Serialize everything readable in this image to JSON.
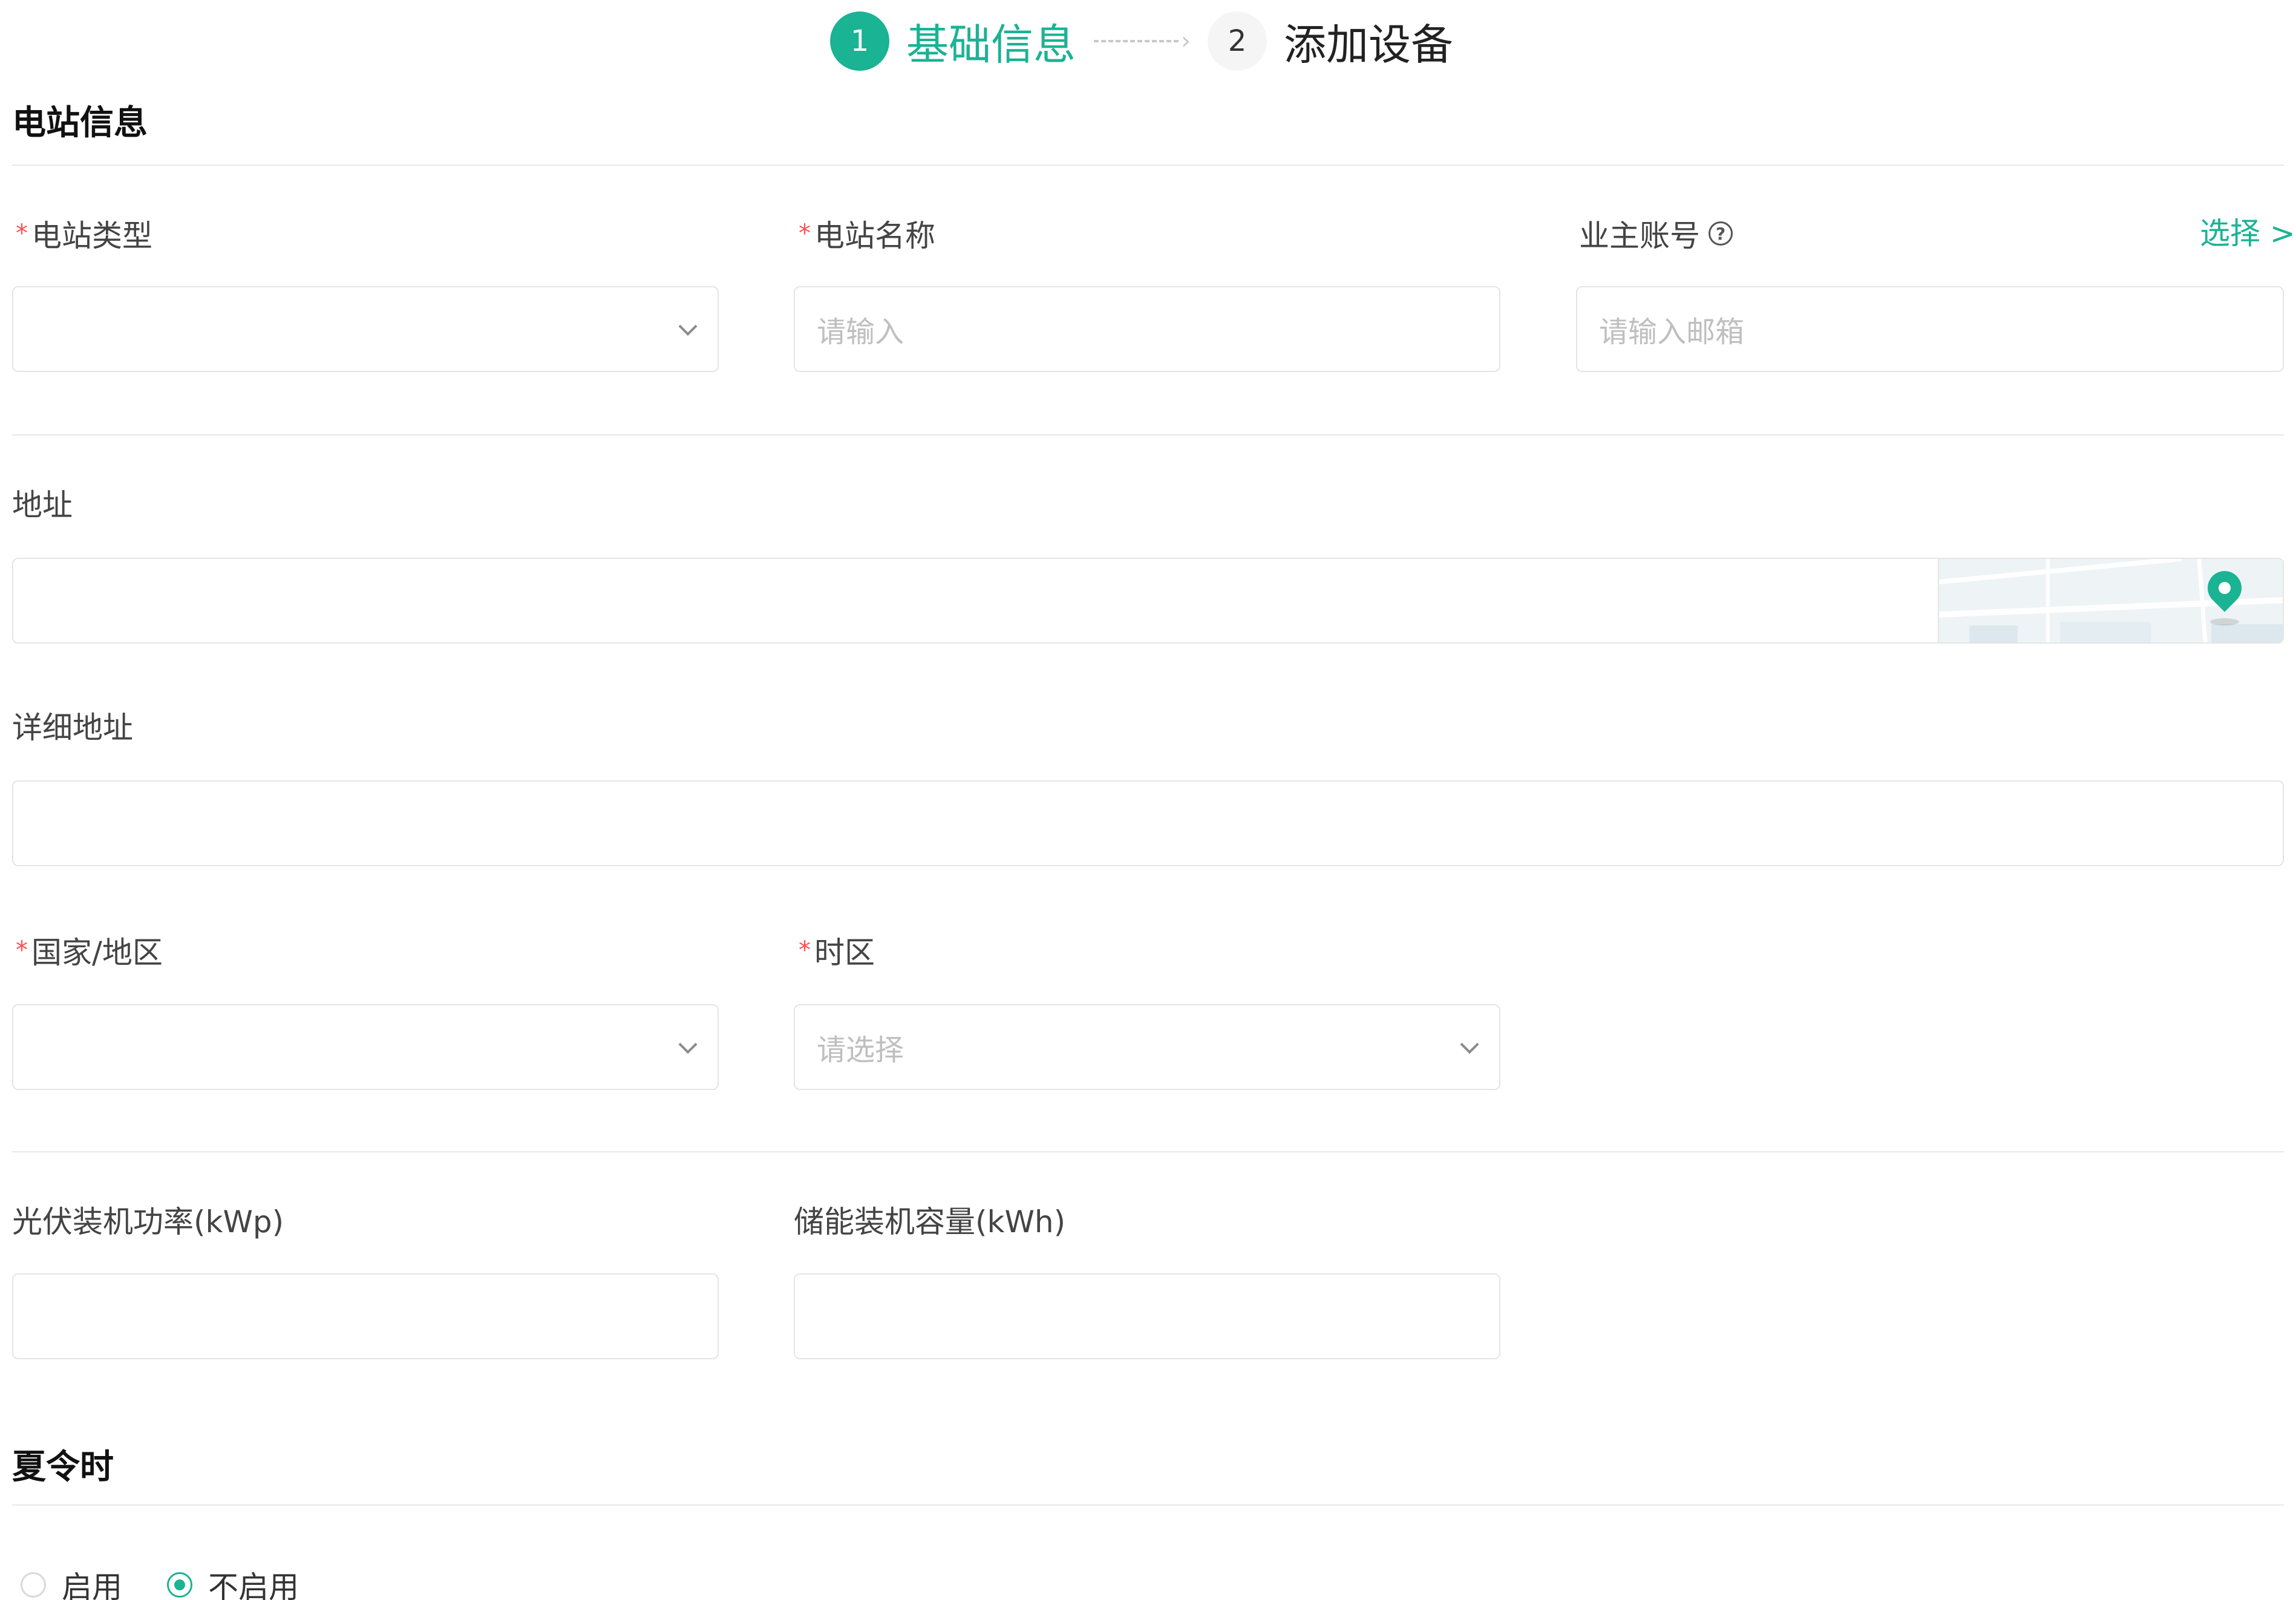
{
  "stepper": {
    "steps": [
      {
        "number": "1",
        "label": "基础信息",
        "state": "active"
      },
      {
        "number": "2",
        "label": "添加设备",
        "state": "inactive"
      }
    ]
  },
  "colors": {
    "accent": "#1ab394",
    "required": "#ff4d4f",
    "border": "#e5e5e5"
  },
  "station_section": {
    "title": "电站信息",
    "station_type": {
      "label": "电站类型",
      "required": true,
      "value": "",
      "placeholder": ""
    },
    "station_name": {
      "label": "电站名称",
      "required": true,
      "value": "",
      "placeholder": "请输入"
    },
    "owner_account": {
      "label": "业主账号",
      "help_icon": "question-circle-icon",
      "select_link": "选择 >",
      "value": "",
      "placeholder": "请输入邮箱"
    },
    "address": {
      "label": "地址",
      "value": "",
      "map_icon": "map-pin-icon"
    },
    "detail_address": {
      "label": "详细地址",
      "value": ""
    },
    "country": {
      "label": "国家/地区",
      "required": true,
      "value": ""
    },
    "timezone": {
      "label": "时区",
      "required": true,
      "value": "",
      "placeholder": "请选择"
    },
    "pv_capacity": {
      "label": "光伏装机功率(kWp)",
      "value": ""
    },
    "storage_capacity": {
      "label": "储能装机容量(kWh)",
      "value": ""
    }
  },
  "dst_section": {
    "title": "夏令时",
    "options": [
      {
        "label": "启用",
        "checked": false
      },
      {
        "label": "不启用",
        "checked": true
      }
    ]
  }
}
